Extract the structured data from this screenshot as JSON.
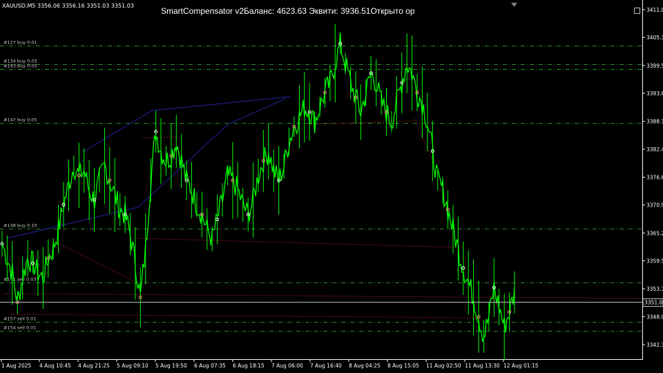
{
  "symbol_info": "XAUUSD,M5  3356.06 3356.16 3351.03 3351.03",
  "ea_title": "SmartCompensator v2Баланс: 4623.63  Эквити: 3936.51Открыто ор",
  "current_price_label": "3351.03",
  "colors": {
    "background": "#000000",
    "candles": "#00ff00",
    "grid": "#1a1a1a",
    "order_lines": "#2e8b2e",
    "axis": "#ffffff",
    "current_price": "#c0c0c0",
    "trend_line_red": "#8b1a1a",
    "trend_line_blue": "#191970"
  },
  "chart_data": {
    "type": "line",
    "title": "",
    "xlabel": "",
    "ylabel": "",
    "ylim": [
      3338.0,
      3411.0
    ],
    "y_ticks": [
      "3411.00",
      "3405.30",
      "3399.55",
      "3393.85",
      "3388.10",
      "3382.40",
      "3376.65",
      "3370.95",
      "3365.20",
      "3359.50",
      "3353.75",
      "3348.05",
      "3342.30"
    ],
    "x_ticks": [
      "1 Aug 2025",
      "4 Aug 10:45",
      "4 Aug 21:25",
      "5 Aug 09:10",
      "5 Aug 19:50",
      "6 Aug 07:35",
      "6 Aug 18:15",
      "7 Aug 06:00",
      "7 Aug 16:40",
      "8 Aug 04:25",
      "8 Aug 15:05",
      "11 Aug 02:50",
      "11 Aug 13:30",
      "12 Aug 01:15"
    ],
    "series": [
      {
        "values": [
          3363,
          3360,
          3357,
          3351,
          3356,
          3360,
          3359,
          3357,
          3356,
          3360,
          3362,
          3366,
          3371,
          3375,
          3379,
          3377,
          3378,
          3374,
          3372,
          3376,
          3379,
          3376,
          3373,
          3370,
          3369,
          3365,
          3359,
          3352,
          3362,
          3376,
          3386,
          3382,
          3380,
          3381,
          3384,
          3380,
          3376,
          3374,
          3371,
          3369,
          3366,
          3364,
          3368,
          3372,
          3377,
          3376,
          3374,
          3371,
          3369,
          3372,
          3377,
          3380,
          3382,
          3378,
          3376,
          3379,
          3384,
          3387,
          3389,
          3391,
          3390,
          3388,
          3391,
          3394,
          3396,
          3400,
          3404,
          3400,
          3396,
          3393,
          3390,
          3394,
          3398,
          3396,
          3392,
          3390,
          3388,
          3392,
          3396,
          3400,
          3398,
          3394,
          3392,
          3388,
          3382,
          3376,
          3374,
          3370,
          3366,
          3362,
          3358,
          3355,
          3352,
          3348,
          3344,
          3348,
          3354,
          3350,
          3346,
          3349,
          3353
        ]
      }
    ],
    "order_levels": [
      {
        "label": "#127 buy 0.01",
        "price": 3403.6
      },
      {
        "label": "#134 buy 0.03",
        "price": 3399.8
      },
      {
        "label": "#143 buy 0.05",
        "price": 3398.8
      },
      {
        "label": "#147 buy 0.05",
        "price": 3387.8
      },
      {
        "label": "#148 buy 0.10",
        "price": 3366.1
      },
      {
        "label": "#151 sell 0.03",
        "price": 3355.0
      },
      {
        "label": "#157 sell 0.01",
        "price": 3347.0
      },
      {
        "label": "#154 sell 0.01",
        "price": 3345.1
      }
    ],
    "current_price": 3351.03,
    "grid": false,
    "legend": "none"
  }
}
